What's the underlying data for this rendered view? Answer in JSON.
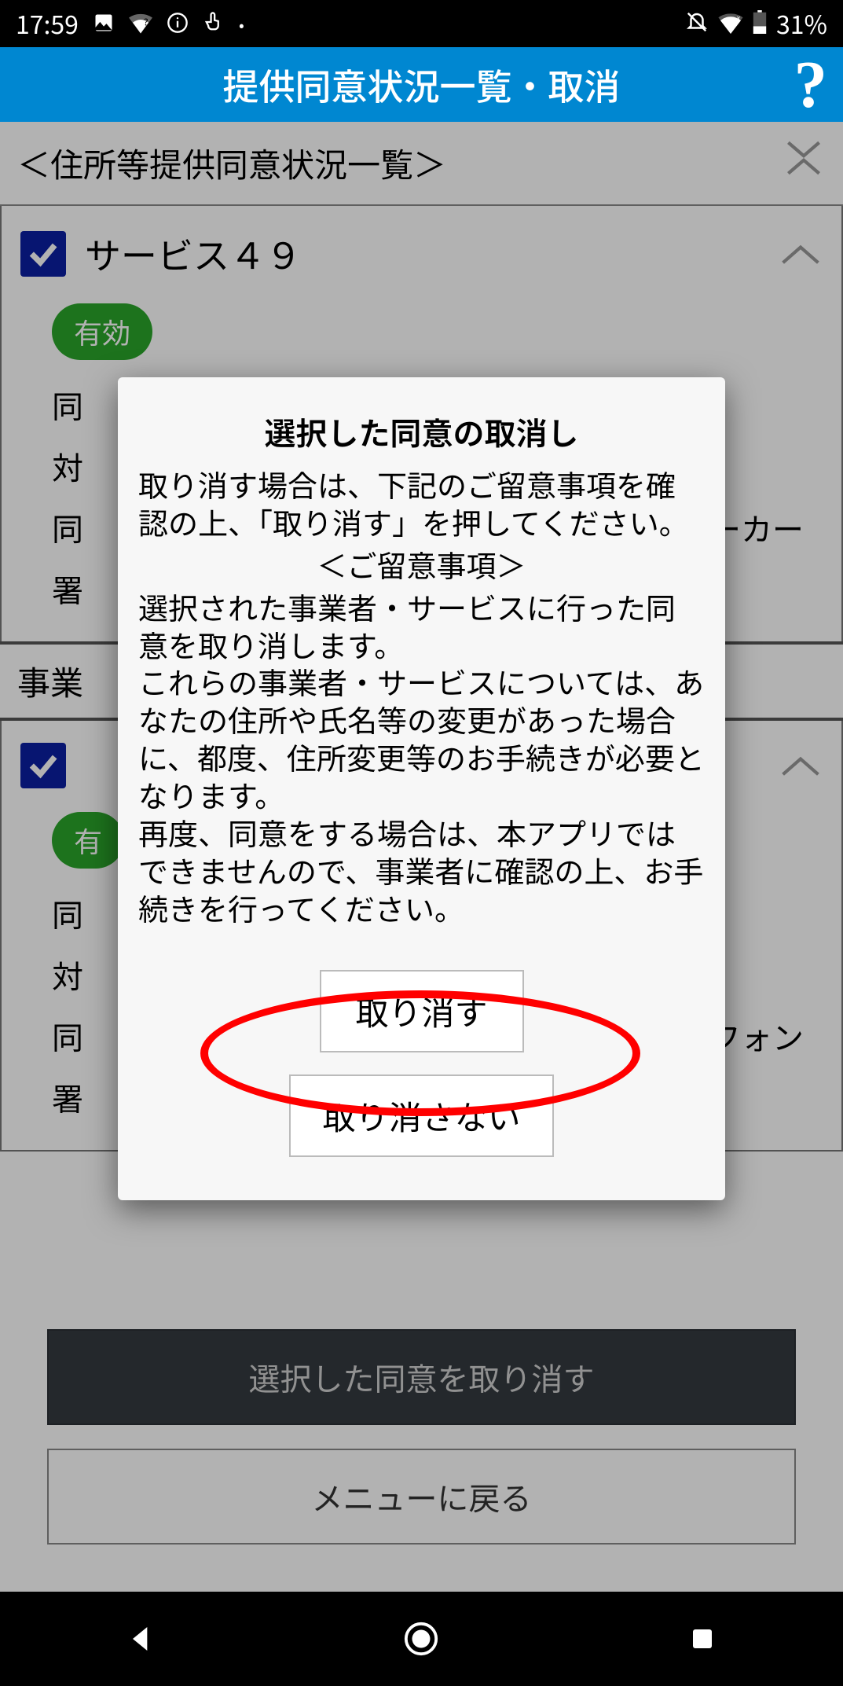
{
  "status": {
    "time": "17:59",
    "battery": "31%"
  },
  "header": {
    "title": "提供同意状況一覧・取消"
  },
  "subheader": {
    "title": "＜住所等提供同意状況一覧＞"
  },
  "cards": [
    {
      "title": "サービス４９",
      "badge": "有効",
      "field1_label": "同",
      "field2_label": "対",
      "field3_label": "同",
      "field3_tail": "バーカー",
      "field4_label": "署"
    },
    {
      "title": "",
      "badge": "有",
      "field1_label": "同",
      "field2_label": "対",
      "field3_label": "同",
      "field3_tail": "フォン",
      "field4_label": "署"
    }
  ],
  "section_label": "事業",
  "modal": {
    "title": "選択した同意の取消し",
    "text1": "取り消す場合は、下記のご留意事項を確認の上、「取り消す」を押してください。",
    "notes_label": "＜ご留意事項＞",
    "text2": "選択された事業者・サービスに行った同意を取り消します。",
    "text3": "これらの事業者・サービスについては、あなたの住所や氏名等の変更があった場合に、都度、住所変更等のお手続きが必要となります。",
    "text4": "再度、同意をする場合は、本アプリではできませんので、事業者に確認の上、お手続きを行ってください。",
    "confirm": "取り消す",
    "cancel": "取り消さない"
  },
  "buttons": {
    "primary": "選択した同意を取り消す",
    "secondary": "メニューに戻る"
  },
  "annotation_color": "#ff0000"
}
